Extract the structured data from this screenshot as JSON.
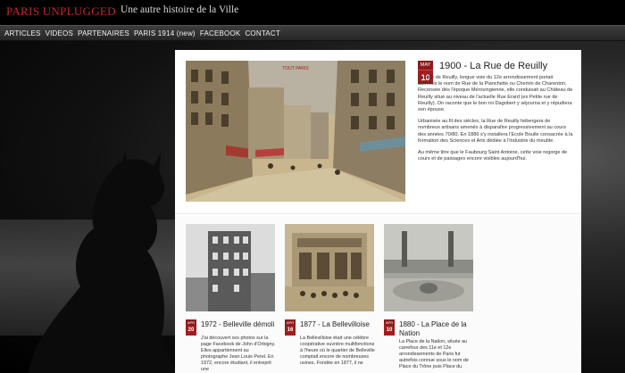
{
  "site": {
    "title": "PARIS UNPLUGGED",
    "tagline": "Une autre histoire de la Ville",
    "brand_color": "#c9252b"
  },
  "nav": {
    "items": [
      "ARTICLES",
      "VIDEOS",
      "PARTENAIRES",
      "PARIS 1914 (new)",
      "FACEBOOK",
      "CONTACT"
    ]
  },
  "featured": {
    "month": "MAY",
    "day": "10",
    "title": "1900 - La Rue de Reuilly",
    "image_caption": "TOUT PARIS",
    "paragraphs": [
      "La Rue de Reuilly, longue voie du 12e arrondissement portait autrefois le nom de Rue de la Planchette ou Chemin de Charenton. Recensée dès l'époque Mérovingienne, elle conduisait au Château de Reuilly situé au niveau de l'actuelle Rue Erard (ex Petite rue de Reuilly). On raconte que le bon roi Dagobert y séjourna et y répudiera son épouse.",
      "Urbanisée au fil des siècles, la Rue de Reuilly hébergera de nombreux artisans amenés à disparaître progressivement au cours des années 70/80. En 1886 s'y installera l'Ecole Boulle consacrée à la formation des Sciences et Arts dédiée à l'industrie du meuble.",
      "Au même titre que le Faubourg Saint Antoine, cette voie regorge de cours et de passages encore visibles aujourd'hui."
    ]
  },
  "articles": [
    {
      "month": "APR",
      "day": "20",
      "title": "1972 - Belleville démoli",
      "body": "J'ai découvert ces photos sur la page Facebook de John d'Orbigny. Elles appartiennent au photographe Jean Louis Perel. En 1972, encore étudiant, il entreprit une"
    },
    {
      "month": "APR",
      "day": "16",
      "title": "1877 - La Bellevilloise",
      "body": "La Bellevilloise était une célèbre coopérative ouvrière multifonctions à l'heure où le quartier de Belleville comptait encore de nombreuses usines. Fondée en 1877, il ne"
    },
    {
      "month": "APR",
      "day": "10",
      "title": "1880 - La Place de la Nation",
      "body": "La Place de la Nation, située au carrefour des 11e et 12e arrondissements de Paris fut autrefois connue sous le nom de Place du Trône puis Place du"
    }
  ]
}
